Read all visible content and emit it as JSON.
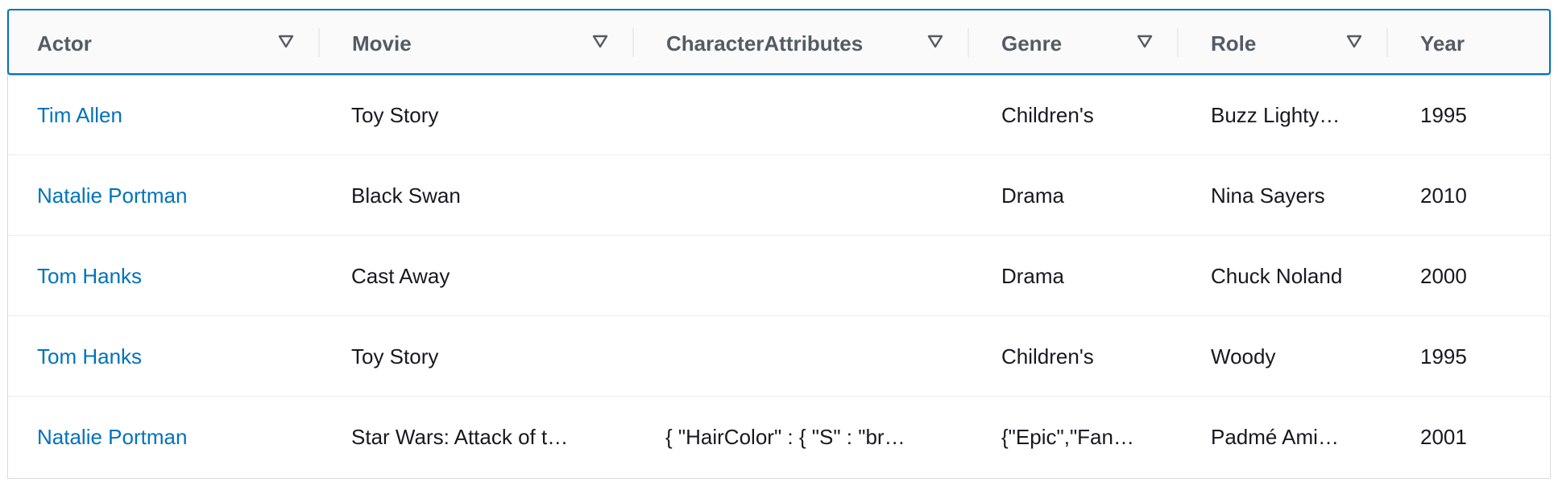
{
  "table": {
    "columns": [
      {
        "label": "Actor",
        "sortable": true
      },
      {
        "label": "Movie",
        "sortable": true
      },
      {
        "label": "CharacterAttributes",
        "sortable": true
      },
      {
        "label": "Genre",
        "sortable": true
      },
      {
        "label": "Role",
        "sortable": true
      },
      {
        "label": "Year",
        "sortable": false
      }
    ],
    "rows": [
      {
        "actor": "Tim Allen",
        "movie": "Toy Story",
        "attributes": "",
        "genre": "Children's",
        "role": "Buzz Lighty…",
        "year": "1995"
      },
      {
        "actor": "Natalie Portman",
        "movie": "Black Swan",
        "attributes": "",
        "genre": "Drama",
        "role": "Nina Sayers",
        "year": "2010"
      },
      {
        "actor": "Tom Hanks",
        "movie": "Cast Away",
        "attributes": "",
        "genre": "Drama",
        "role": "Chuck Noland",
        "year": "2000"
      },
      {
        "actor": "Tom Hanks",
        "movie": "Toy Story",
        "attributes": "",
        "genre": "Children's",
        "role": "Woody",
        "year": "1995"
      },
      {
        "actor": "Natalie Portman",
        "movie": "Star Wars: Attack of t…",
        "attributes": "{ \"HairColor\" : { \"S\" : \"br…",
        "genre": "{\"Epic\",\"Fan…",
        "role": "Padmé Ami…",
        "year": "2001"
      }
    ]
  },
  "colors": {
    "accent": "#0073bb",
    "header_text": "#545b64",
    "text": "#16191f",
    "row_border": "#eaeded"
  },
  "icons": {
    "filter": "filter-triangle-icon"
  }
}
